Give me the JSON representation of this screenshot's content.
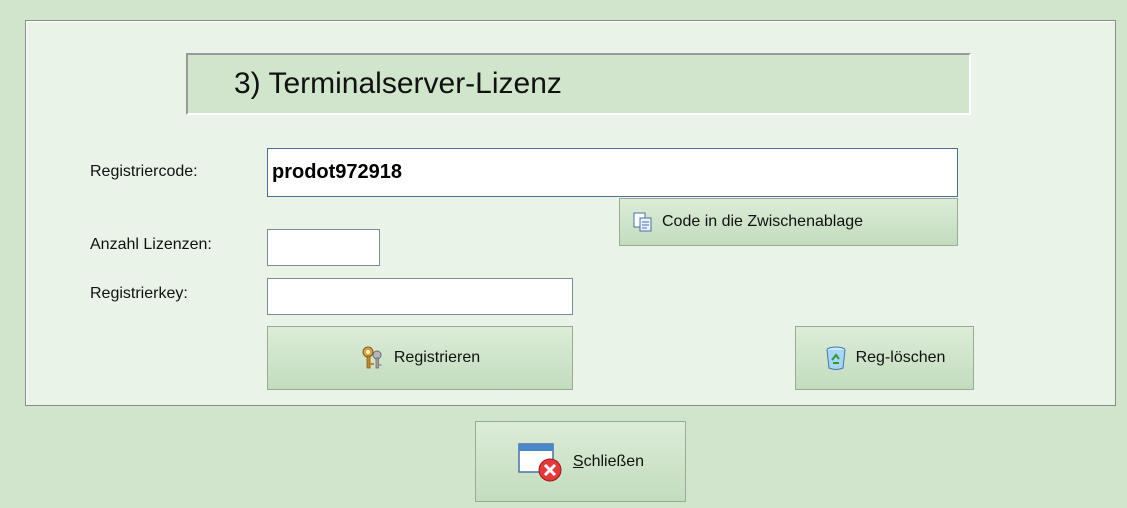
{
  "dialog": {
    "title": "3) Terminalserver-Lizenz"
  },
  "fields": {
    "registriercode_label": "Registriercode:",
    "registriercode_value": "prodot972918",
    "anzahl_label": "Anzahl Lizenzen:",
    "anzahl_value": "",
    "registrierkey_label": "Registrierkey:",
    "registrierkey_value": ""
  },
  "buttons": {
    "copy_label": "Code in die Zwischenablage",
    "register_label": "Registrieren",
    "regdelete_label": "Reg-löschen",
    "close_label": "Schließen"
  },
  "icons": {
    "copy": "copy-icon",
    "register": "keys-icon",
    "regdelete": "recycle-bin-icon",
    "close": "window-close-icon"
  },
  "colors": {
    "background": "#d1e5cd",
    "panel": "#e9f3e7",
    "close_red": "#e03a3a"
  }
}
